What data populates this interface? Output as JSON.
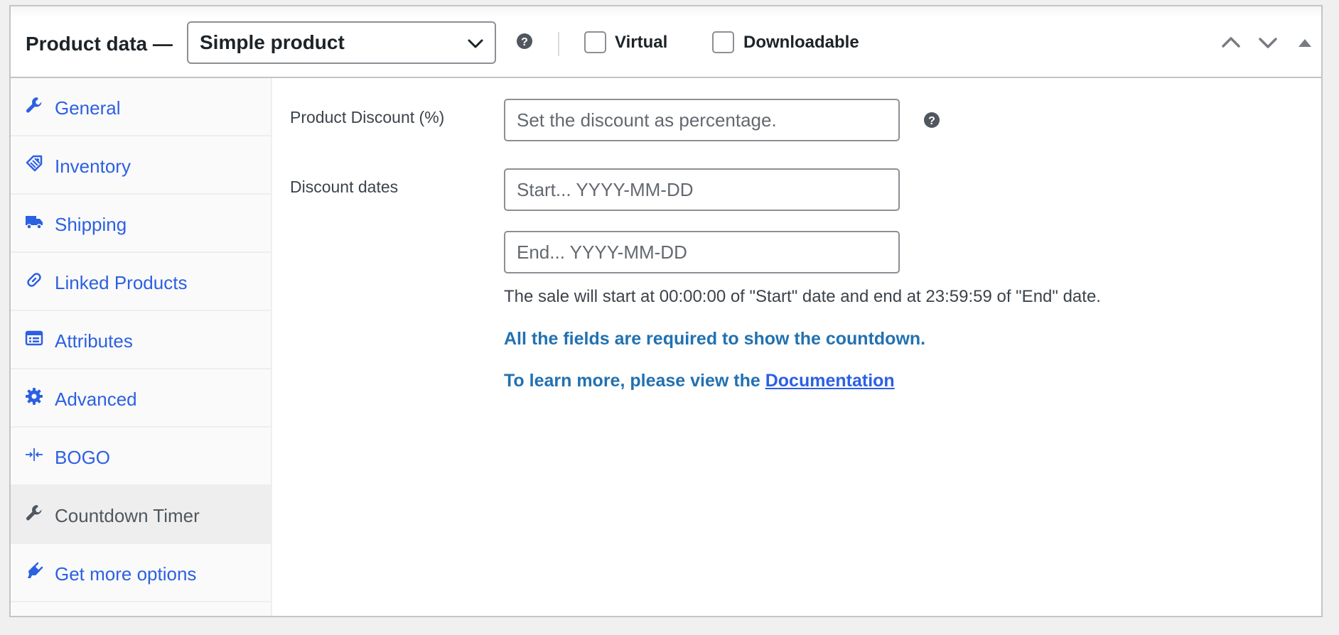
{
  "header": {
    "title": "Product data —",
    "product_type": {
      "selected": "Simple product",
      "icon": "chevron-down-icon"
    },
    "help_icon": "question-circle-icon",
    "virtual_label": "Virtual",
    "virtual_checked": false,
    "downloadable_label": "Downloadable",
    "downloadable_checked": false,
    "controls": [
      "chevron-up-icon",
      "chevron-down-icon",
      "triangle-up-icon"
    ]
  },
  "tabs": [
    {
      "label": "General",
      "icon": "wrench-icon"
    },
    {
      "label": "Inventory",
      "icon": "tag-icon"
    },
    {
      "label": "Shipping",
      "icon": "truck-icon"
    },
    {
      "label": "Linked Products",
      "icon": "link-icon"
    },
    {
      "label": "Attributes",
      "icon": "list-card-icon"
    },
    {
      "label": "Advanced",
      "icon": "gear-icon"
    },
    {
      "label": "BOGO",
      "icon": "collapse-horizontal-icon"
    },
    {
      "label": "Countdown Timer",
      "icon": "wrench-icon",
      "active": true
    },
    {
      "label": "Get more options",
      "icon": "plugin-icon"
    }
  ],
  "form": {
    "discount_label": "Product Discount (%)",
    "discount_placeholder": "Set the discount as percentage.",
    "dates_label": "Discount dates",
    "start_placeholder": "Start... YYYY-MM-DD",
    "end_placeholder": "End... YYYY-MM-DD",
    "description": "The sale will start at 00:00:00 of \"Start\" date and end at 23:59:59 of \"End\" date.",
    "required_notice": "All the fields are required to show the countdown.",
    "learn_more_text": "To learn more, please view the ",
    "documentation_link": "Documentation"
  },
  "colors": {
    "link": "#2271b1",
    "link_bright": "#2c60e3",
    "icon_blue": "#2c60e3",
    "active_tab_bg": "#eeeeee"
  }
}
